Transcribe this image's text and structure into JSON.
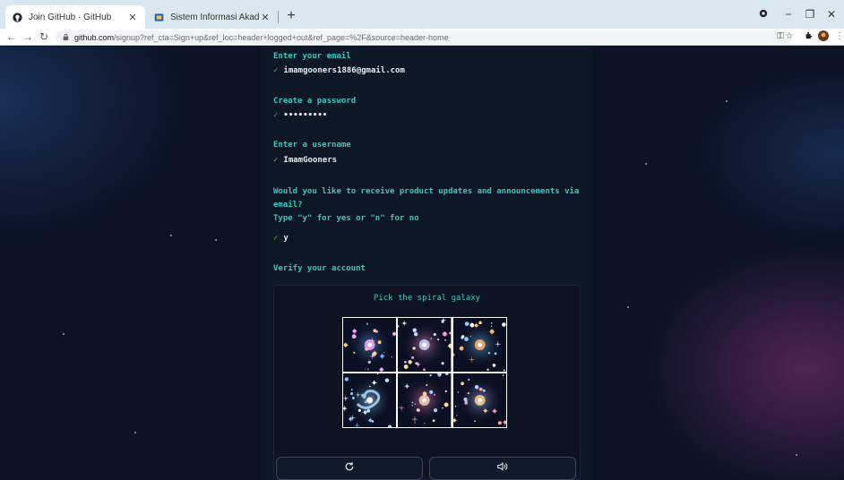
{
  "browser": {
    "tabs": [
      {
        "title": "Join GitHub · GitHub",
        "active": true
      },
      {
        "title": "Sistem Informasi Akademik",
        "active": false
      }
    ],
    "address": {
      "domain": "github.com",
      "path": "/signup?ref_cta=Sign+up&ref_loc=header+logged+out&ref_page=%2F&source=header-home"
    },
    "window_controls": {
      "minimize": "−",
      "restore": "❐",
      "close": "✕"
    }
  },
  "signup": {
    "email": {
      "prompt": "Enter your email",
      "value": "imamgooners1886@gmail.com"
    },
    "password": {
      "prompt": "Create a password",
      "value": "•••••••••"
    },
    "username": {
      "prompt": "Enter a username",
      "value": "ImamGooners"
    },
    "updates": {
      "prompt_line1": "Would you like to receive product updates and announcements via",
      "prompt_line2": "email?",
      "prompt_line3": "Type \"y\" for yes or \"n\" for no",
      "value": "y"
    },
    "verify": {
      "heading": "Verify your account",
      "captcha_title": "Pick the spiral galaxy",
      "images": [
        "galaxy-option-1",
        "galaxy-option-2",
        "galaxy-option-3",
        "galaxy-option-4",
        "galaxy-option-5",
        "galaxy-option-6"
      ],
      "reload_icon": "reload-icon",
      "audio_icon": "audio-icon"
    }
  },
  "colors": {
    "accent": "#37c7c1",
    "check": "#3fb950",
    "panel": "#0e1726",
    "background": "#0b1325"
  }
}
